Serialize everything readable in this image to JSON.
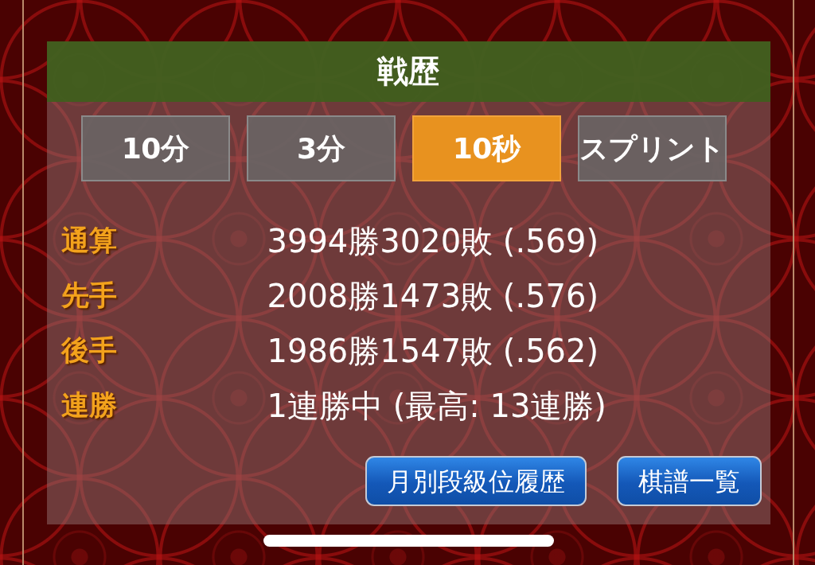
{
  "title": "戦歴",
  "tabs": [
    {
      "label": "10分",
      "selected": false
    },
    {
      "label": "3分",
      "selected": false
    },
    {
      "label": "10秒",
      "selected": true
    },
    {
      "label": "スプリント",
      "selected": false
    }
  ],
  "stats": [
    {
      "label": "通算",
      "value": "3994勝3020敗 (.569)"
    },
    {
      "label": "先手",
      "value": "2008勝1473敗 (.576)"
    },
    {
      "label": "後手",
      "value": "1986勝1547敗 (.562)"
    },
    {
      "label": "連勝",
      "value": "1連勝中 (最高: 13連勝)"
    }
  ],
  "buttons": [
    "月別段級位履歴",
    "棋譜一覧"
  ]
}
